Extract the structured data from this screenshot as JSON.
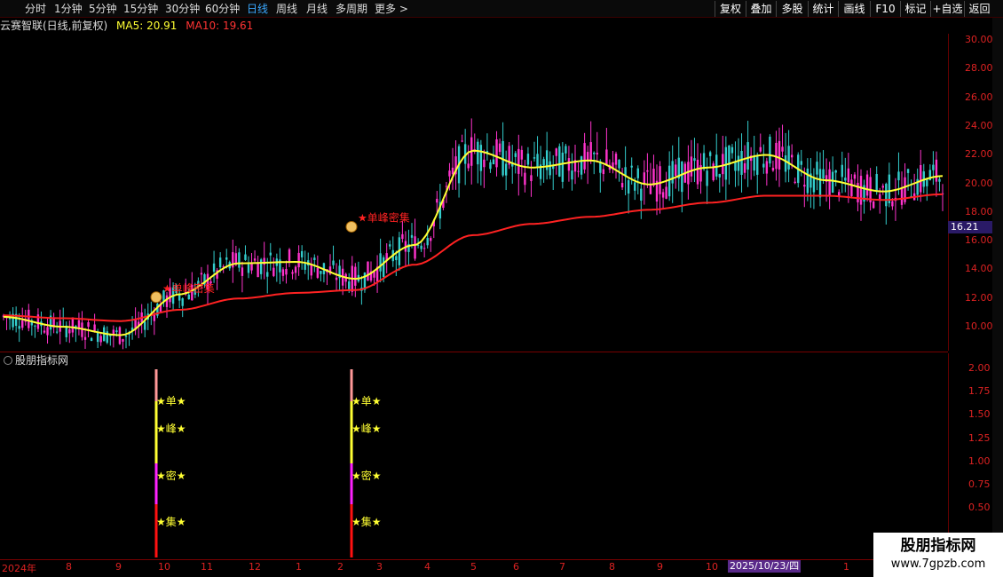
{
  "toolbar": {
    "periods": [
      "分时",
      "1分钟",
      "5分钟",
      "15分钟",
      "30分钟",
      "60分钟",
      "日线",
      "周线",
      "月线",
      "多周期",
      "更多 >"
    ],
    "active_period": "日线",
    "tools": [
      "复权",
      "叠加",
      "多股",
      "统计",
      "画线",
      "F10",
      "标记",
      "+自选",
      "返回"
    ]
  },
  "header": {
    "security": "云赛智联(日线,前复权)",
    "ma5": "MA5: 20.91",
    "ma10": "MA10: 19.61"
  },
  "price_axis": {
    "ticks": [
      "30.00",
      "28.00",
      "26.00",
      "24.00",
      "22.00",
      "20.00",
      "18.00",
      "16.00",
      "14.00",
      "12.00",
      "10.00"
    ],
    "current_price": "16.21"
  },
  "indicator": {
    "name": "股朋指标网",
    "ticks": [
      "2.00",
      "1.75",
      "1.50",
      "1.25",
      "1.00",
      "0.75",
      "0.50"
    ],
    "labels": [
      "★单★",
      "★峰★",
      "★密★",
      "★集★"
    ],
    "signal_text": "单峰密集"
  },
  "date_axis": {
    "ticks": [
      "2024年",
      "8",
      "9",
      "10",
      "11",
      "12",
      "1",
      "2",
      "3",
      "4",
      "5",
      "6",
      "7",
      "8",
      "9",
      "10",
      "1"
    ],
    "cursor_date": "2025/10/23/四"
  },
  "watermark": {
    "brand": "股朋指标网",
    "url": "www.7gpzb.com"
  },
  "colors": {
    "up": "#ff33cc",
    "down": "#33cccc",
    "ma_short": "#ffff33",
    "ma_long": "#ff2222",
    "signal": "#ff2222"
  },
  "chart_data": {
    "type": "candlestick",
    "ylim": [
      8.5,
      31.0
    ],
    "x": [
      "2024-07",
      "2024-08",
      "2024-09",
      "2024-10",
      "2024-11",
      "2024-12",
      "2025-01",
      "2025-02",
      "2025-03",
      "2025-04",
      "2025-05",
      "2025-06",
      "2025-07",
      "2025-08",
      "2025-09",
      "2025-10",
      "2026-01"
    ],
    "series": [
      {
        "name": "MA5",
        "values": [
          10.9,
          10.2,
          9.6,
          12.5,
          14.7,
          14.8,
          13.6,
          16.0,
          22.7,
          21.5,
          22.0,
          20.3,
          21.5,
          22.4,
          20.6,
          19.8,
          20.9
        ]
      },
      {
        "name": "MA10",
        "values": [
          11.0,
          10.8,
          10.6,
          11.4,
          12.2,
          12.6,
          12.8,
          14.6,
          16.7,
          17.5,
          18.0,
          18.5,
          19.0,
          19.5,
          19.5,
          19.2,
          19.6
        ]
      }
    ],
    "signals": [
      {
        "date": "2024-10",
        "price": 12.8,
        "label": "单峰密集"
      },
      {
        "date": "2025-02",
        "price": 17.8,
        "label": "单峰密集"
      }
    ]
  }
}
